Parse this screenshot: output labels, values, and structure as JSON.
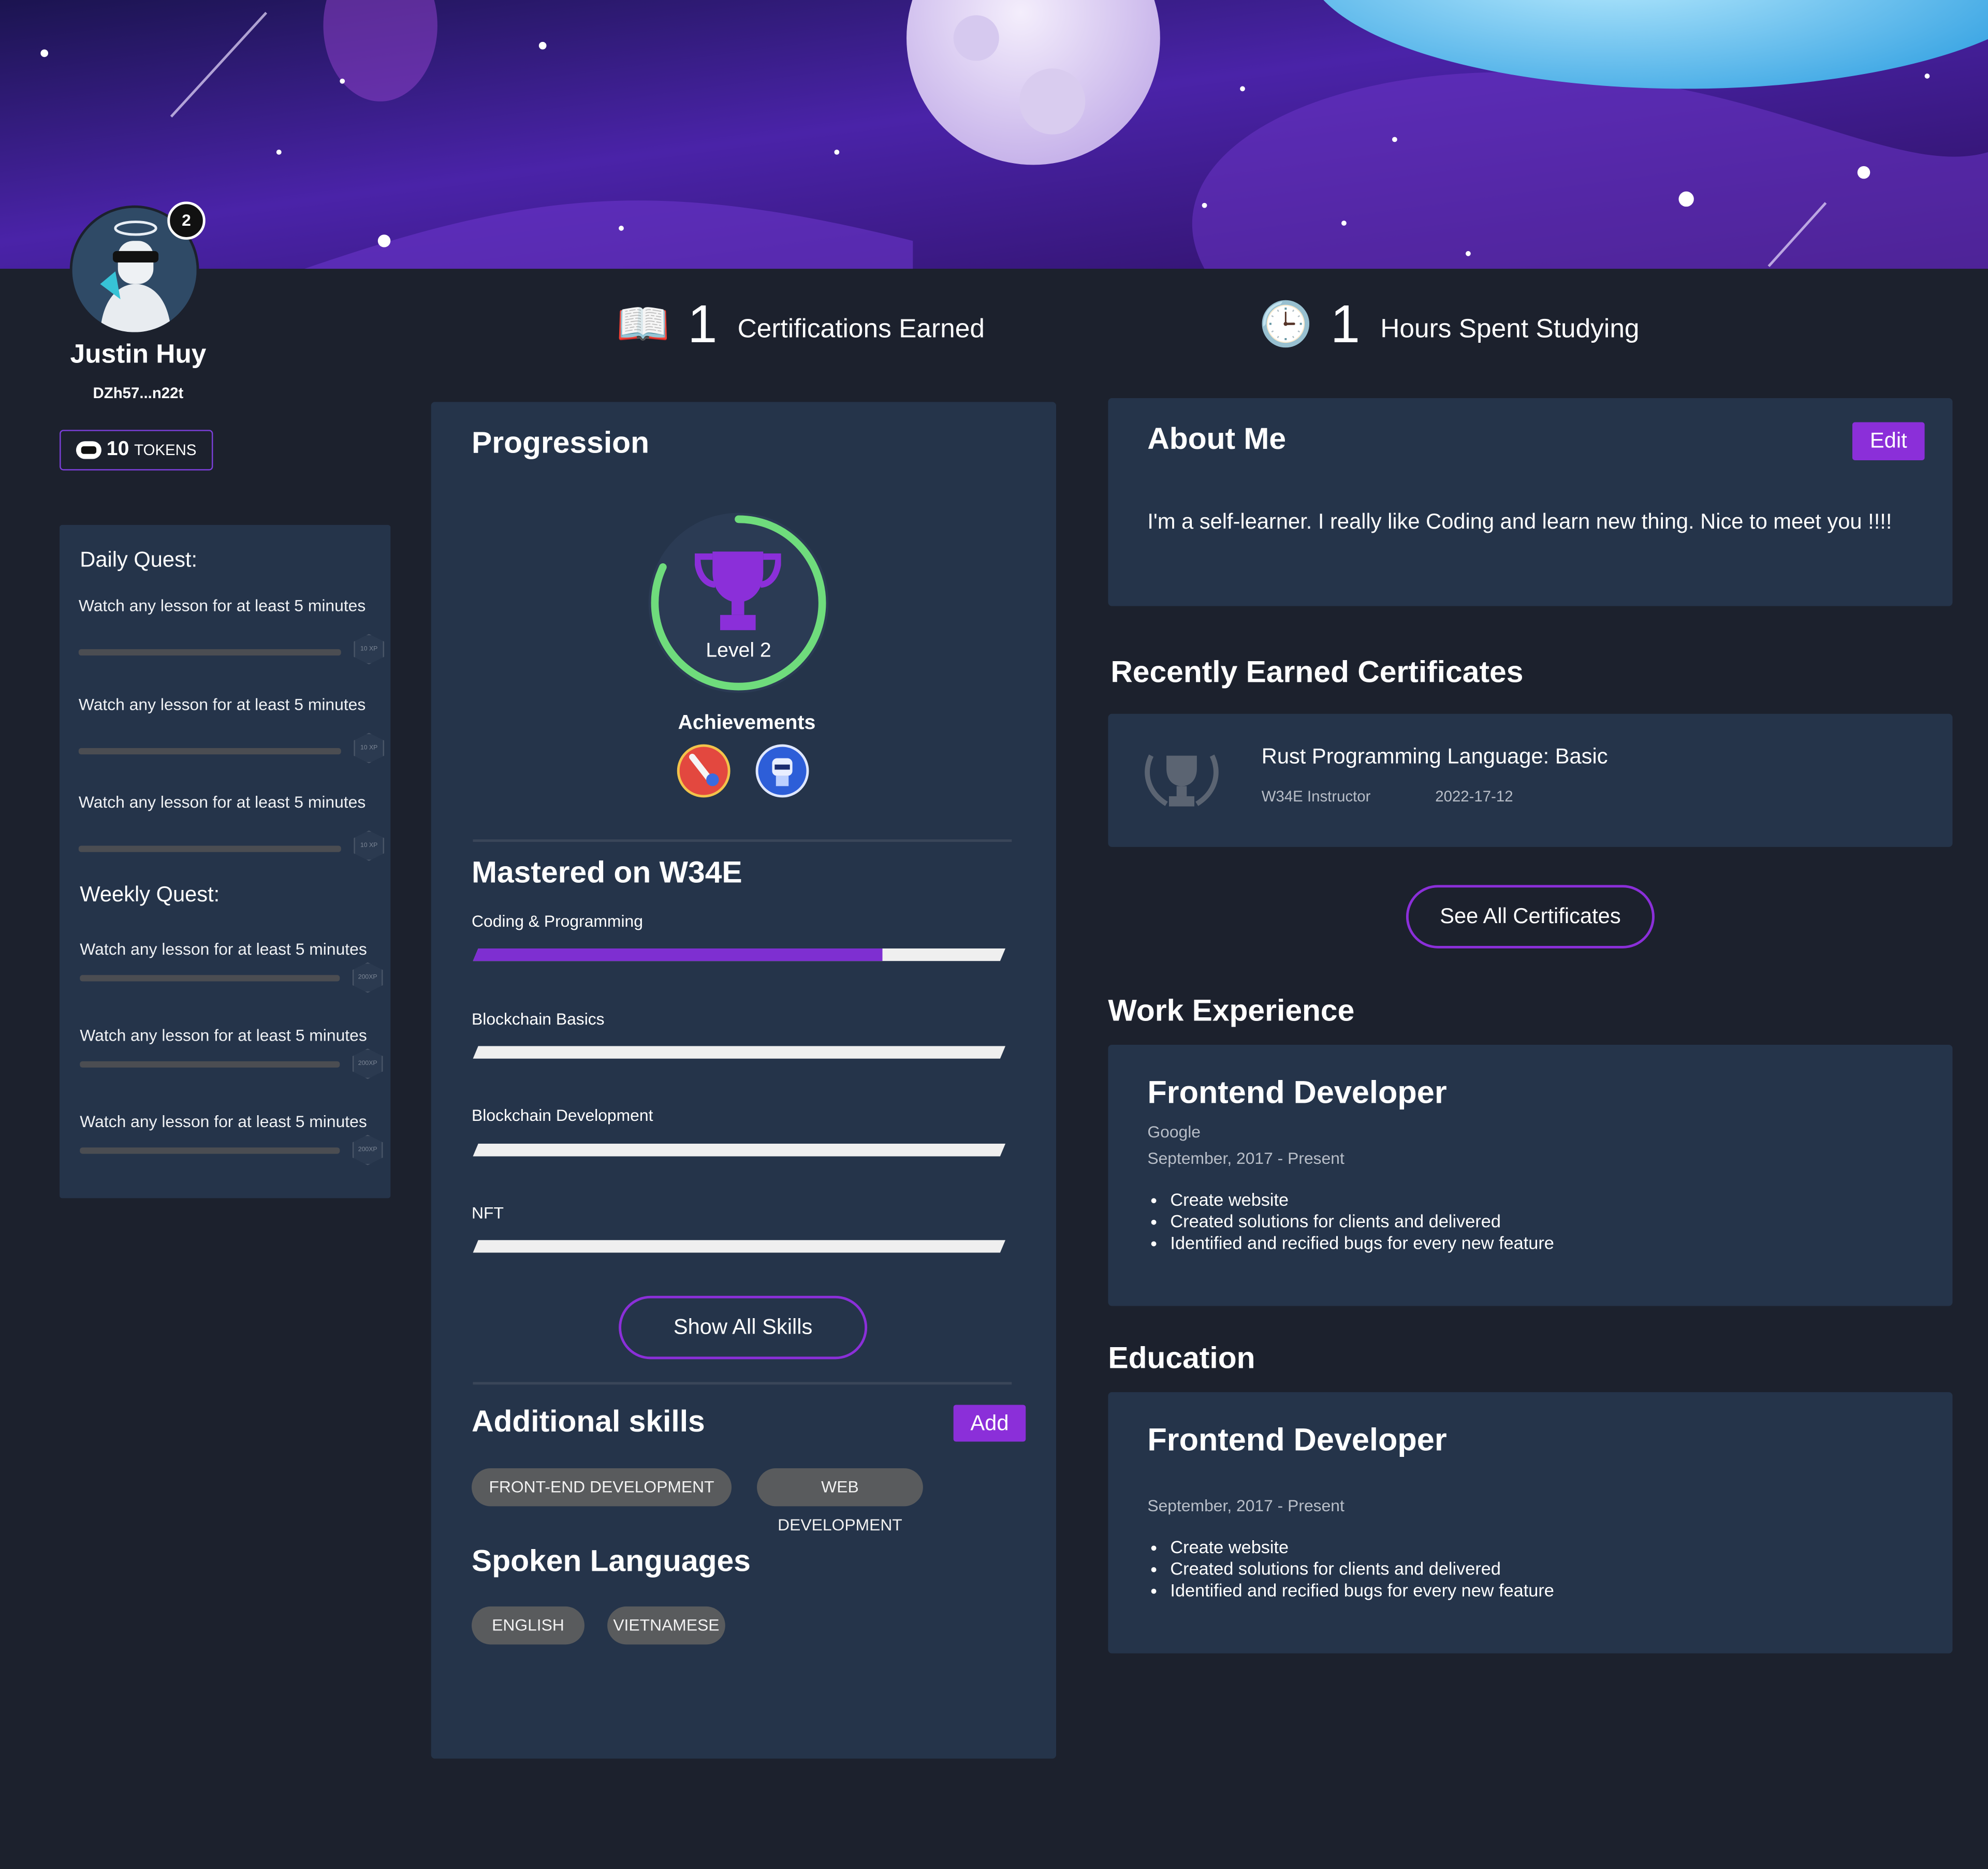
{
  "profile": {
    "name": "Justin Huy",
    "wallet": "DZh57...n22t",
    "level_badge": "2",
    "tokens_value": "10",
    "tokens_label": "TOKENS"
  },
  "quests": {
    "daily_title": "Daily Quest:",
    "daily": [
      {
        "text": "Watch any lesson for at least 5 minutes",
        "xp": "10 XP",
        "progress": 0
      },
      {
        "text": "Watch any lesson for at least 5 minutes",
        "xp": "10 XP",
        "progress": 0
      },
      {
        "text": "Watch any lesson for at least 5 minutes",
        "xp": "10 XP",
        "progress": 0
      }
    ],
    "weekly_title": "Weekly Quest:",
    "weekly": [
      {
        "text": "Watch any lesson for at least 5 minutes",
        "xp": "200XP",
        "progress": 0
      },
      {
        "text": "Watch any lesson for at least 5 minutes",
        "xp": "200XP",
        "progress": 0
      },
      {
        "text": "Watch any lesson for at least 5 minutes",
        "xp": "200XP",
        "progress": 0
      }
    ]
  },
  "stats": {
    "certifications_value": "1",
    "certifications_label": "Certifications Earned",
    "hours_value": "1",
    "hours_label": "Hours Spent Studying"
  },
  "progression": {
    "title": "Progression",
    "level_label": "Level 2",
    "level_progress": 0.82,
    "achievements_title": "Achievements",
    "mastered_title": "Mastered on W34E",
    "skills": [
      {
        "name": "Coding & Programming",
        "progress": 0.77
      },
      {
        "name": "Blockchain Basics",
        "progress": 0
      },
      {
        "name": "Blockchain Development",
        "progress": 0
      },
      {
        "name": "NFT",
        "progress": 0
      }
    ],
    "show_all_label": "Show All Skills",
    "additional_title": "Additional skills",
    "add_label": "Add",
    "additional_skills": [
      "FRONT-END DEVELOPMENT",
      "WEB DEVELOPMENT"
    ],
    "languages_title": "Spoken Languages",
    "languages": [
      "ENGLISH",
      "VIETNAMESE"
    ]
  },
  "about": {
    "title": "About Me",
    "edit_label": "Edit",
    "text": "I'm a self-learner. I really like Coding and learn new thing. Nice to meet you !!!!"
  },
  "certificates": {
    "title": "Recently Earned Certificates",
    "items": [
      {
        "name": "Rust Programming Language: Basic",
        "issuer": "W34E Instructor",
        "date": "2022-17-12"
      }
    ],
    "see_all_label": "See All Certificates"
  },
  "work": {
    "title": "Work Experience",
    "items": [
      {
        "role": "Frontend Developer",
        "company": "Google",
        "period": "September, 2017 - Present",
        "bullets": [
          "Create website",
          "Created solutions for clients and delivered",
          "Identified and recified bugs for every new feature"
        ]
      }
    ]
  },
  "education": {
    "title": "Education",
    "items": [
      {
        "role": "Frontend Developer",
        "period": "September, 2017 - Present",
        "bullets": [
          "Create website",
          "Created solutions for clients and delivered",
          "Identified and recified bugs for every new feature"
        ]
      }
    ]
  },
  "colors": {
    "background": "#1c212d",
    "card": "#25344a",
    "accent": "#8b2fd9",
    "level_ring": "#6fdc7c",
    "chip": "#595b5d"
  }
}
